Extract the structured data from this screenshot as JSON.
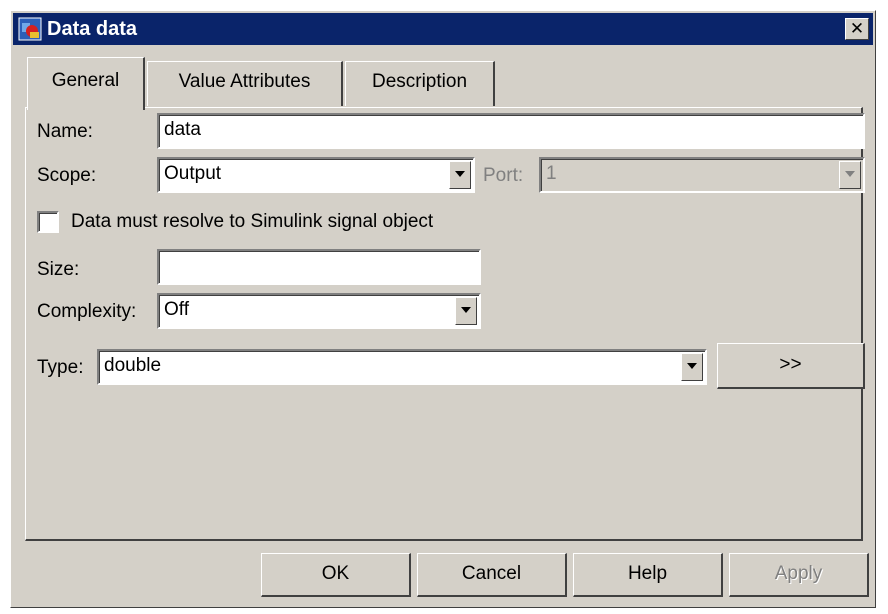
{
  "window": {
    "title": "Data data"
  },
  "tabs": [
    {
      "label": "General"
    },
    {
      "label": "Value Attributes"
    },
    {
      "label": "Description"
    }
  ],
  "form": {
    "name": {
      "label": "Name:",
      "value": "data"
    },
    "scope": {
      "label": "Scope:",
      "value": "Output"
    },
    "port": {
      "label": "Port:",
      "value": "1"
    },
    "resolve_checkbox": {
      "label": "Data must resolve to Simulink signal object",
      "checked": false
    },
    "size": {
      "label": "Size:",
      "value": ""
    },
    "complexity": {
      "label": "Complexity:",
      "value": "Off"
    },
    "type": {
      "label": "Type:",
      "value": "double"
    },
    "expand_button": ">>"
  },
  "buttons": {
    "ok": "OK",
    "cancel": "Cancel",
    "help": "Help",
    "apply": "Apply"
  },
  "colors": {
    "titlebar": "#0a246a",
    "face": "#d4d0c8"
  }
}
